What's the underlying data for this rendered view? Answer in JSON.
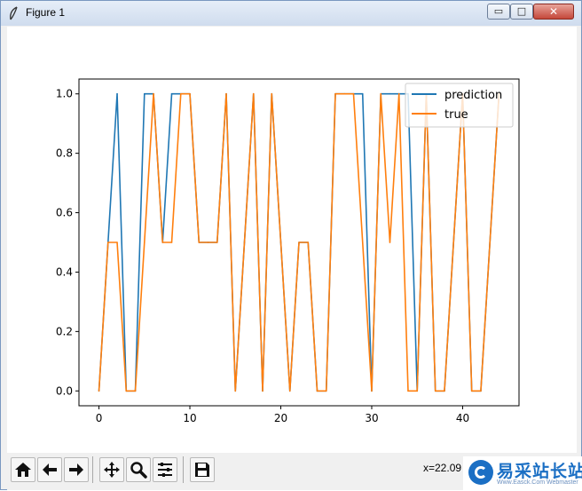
{
  "window": {
    "title": "Figure 1",
    "minimize_glyph": "▭",
    "maximize_glyph": "□",
    "close_glyph": "✕"
  },
  "toolbar": {
    "buttons": [
      "home-icon",
      "back-arrow-icon",
      "forward-arrow-icon",
      "pan-icon",
      "zoom-icon",
      "subplots-config-icon",
      "save-icon"
    ],
    "coords": "x=22.09"
  },
  "watermark": {
    "text": "易采站长站",
    "sub": "Www.Easck.Com  Webmaster"
  },
  "colors": {
    "prediction": "#1f77b4",
    "true": "#ff7f0e"
  },
  "chart_data": {
    "type": "line",
    "x": [
      0,
      1,
      2,
      3,
      4,
      5,
      6,
      7,
      8,
      9,
      10,
      11,
      12,
      13,
      14,
      15,
      16,
      17,
      18,
      19,
      20,
      21,
      22,
      23,
      24,
      25,
      26,
      27,
      28,
      29,
      30,
      31,
      32,
      33,
      34,
      35,
      36,
      37,
      38,
      39,
      40,
      41,
      42,
      43,
      44
    ],
    "xlim": [
      -2.2,
      46.2
    ],
    "ylim": [
      -0.05,
      1.05
    ],
    "xticks": [
      0,
      10,
      20,
      30,
      40
    ],
    "yticks": [
      0.0,
      0.2,
      0.4,
      0.6,
      0.8,
      1.0
    ],
    "xtick_labels": [
      "0",
      "10",
      "20",
      "30",
      "40"
    ],
    "ytick_labels": [
      "0.0",
      "0.2",
      "0.4",
      "0.6",
      "0.8",
      "1.0"
    ],
    "legend_position": "top-right",
    "series": [
      {
        "name": "prediction",
        "values": [
          0,
          0.5,
          1,
          0,
          0,
          1,
          1,
          0.5,
          1,
          1,
          1,
          0.5,
          0.5,
          0.5,
          1,
          0,
          0.5,
          1,
          0,
          1,
          0.5,
          0,
          0.5,
          0.5,
          0,
          0,
          1,
          1,
          1,
          1,
          0,
          1,
          1,
          1,
          1,
          0,
          1,
          0,
          0,
          0.5,
          1,
          0,
          0,
          0.5,
          1
        ]
      },
      {
        "name": "true",
        "values": [
          0,
          0.5,
          0.5,
          0,
          0,
          0.5,
          1,
          0.5,
          0.5,
          1,
          1,
          0.5,
          0.5,
          0.5,
          1,
          0,
          0.5,
          1,
          0,
          1,
          0.5,
          0,
          0.5,
          0.5,
          0,
          0,
          1,
          1,
          1,
          0.5,
          0,
          1,
          0.5,
          1,
          0,
          0,
          1,
          0,
          0,
          0.5,
          1,
          0,
          0,
          0.5,
          1
        ]
      }
    ]
  }
}
